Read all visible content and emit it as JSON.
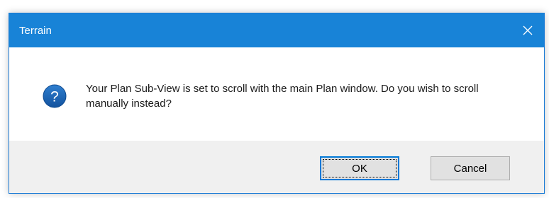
{
  "window": {
    "title": "Terrain",
    "close_icon": "close-icon",
    "titlebar_color": "#1883d7"
  },
  "message": {
    "icon": "question-icon",
    "text": "Your Plan Sub-View is set to scroll with the main Plan window. Do you wish to scroll manually instead?"
  },
  "buttons": {
    "ok_label": "OK",
    "cancel_label": "Cancel"
  }
}
